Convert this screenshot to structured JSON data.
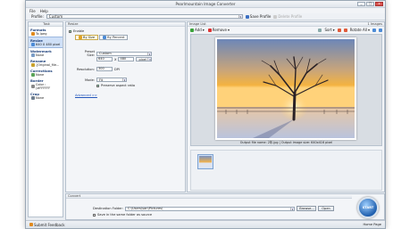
{
  "window": {
    "title": "Pearlmountain Image Converter",
    "minimize": "_",
    "maximize": "□",
    "close": "x"
  },
  "menu": [
    {
      "label": "File"
    },
    {
      "label": "Help"
    }
  ],
  "profile": {
    "label": "Profile:",
    "value": "Custom",
    "save_label": "Save Profile",
    "delete_label": "Delete Profile"
  },
  "tasks": {
    "header": "Task",
    "items": [
      {
        "title": "Formats",
        "value": "To Jpeg"
      },
      {
        "title": "Resize",
        "value": "640 X 480 pixel"
      },
      {
        "title": "Watermark",
        "value": "None"
      },
      {
        "title": "Rename",
        "value": "{Original_file..."
      },
      {
        "title": "Corrections",
        "value": "None"
      },
      {
        "title": "Border",
        "value": "Color : (#FFFFFF"
      },
      {
        "title": "Crop",
        "value": "None"
      }
    ]
  },
  "resize": {
    "header": "Resize",
    "enable_label": "Enable",
    "tab_by_size": "By Size",
    "tab_by_percent": "By Percent",
    "preset_label": "Preset Size:",
    "preset_value": "Custom",
    "width": "640",
    "x_label": "X",
    "height": "480",
    "unit": "pixel",
    "resolution_label": "Resolution:",
    "resolution_value": "300",
    "resolution_unit": "DPI",
    "mode_label": "Mode:",
    "mode_value": "Fit",
    "preserve_label": "Preserve aspect ratio",
    "advanced_label": "Advanced >>"
  },
  "imagelist": {
    "header": "Image List",
    "count": "1 Images",
    "add_label": "Add",
    "remove_label": "Remove",
    "sort_label": "Sort",
    "rotate_label": "Rotate All",
    "output_info": "Output file name: 2年.jpg | Output image size: 640x416 pixel"
  },
  "convert": {
    "header": "Convert",
    "dest_label": "Destination Folder:",
    "dest_value": "C:\\Users\\san\\Pictures\\",
    "browse_label": "Browse...",
    "open_label": "Open",
    "same_folder_label": "Save in the same folder as source",
    "start_label": "START"
  },
  "status": {
    "feedback": "Submit Feedback",
    "home": "Home Page"
  },
  "colors": {
    "accent": "#1f5fae",
    "active_task": "#cfe0f7"
  }
}
